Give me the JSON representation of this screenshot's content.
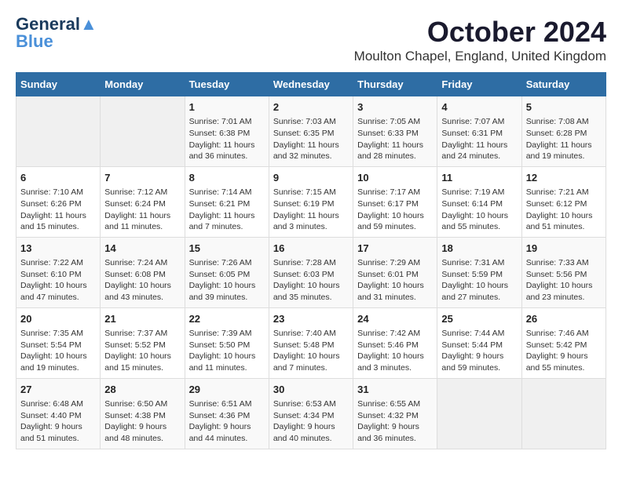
{
  "logo": {
    "line1": "General",
    "line2": "Blue"
  },
  "header": {
    "month_title": "October 2024",
    "location": "Moulton Chapel, England, United Kingdom"
  },
  "days_of_week": [
    "Sunday",
    "Monday",
    "Tuesday",
    "Wednesday",
    "Thursday",
    "Friday",
    "Saturday"
  ],
  "weeks": [
    [
      {
        "day": "",
        "content": ""
      },
      {
        "day": "",
        "content": ""
      },
      {
        "day": "1",
        "content": "Sunrise: 7:01 AM\nSunset: 6:38 PM\nDaylight: 11 hours\nand 36 minutes."
      },
      {
        "day": "2",
        "content": "Sunrise: 7:03 AM\nSunset: 6:35 PM\nDaylight: 11 hours\nand 32 minutes."
      },
      {
        "day": "3",
        "content": "Sunrise: 7:05 AM\nSunset: 6:33 PM\nDaylight: 11 hours\nand 28 minutes."
      },
      {
        "day": "4",
        "content": "Sunrise: 7:07 AM\nSunset: 6:31 PM\nDaylight: 11 hours\nand 24 minutes."
      },
      {
        "day": "5",
        "content": "Sunrise: 7:08 AM\nSunset: 6:28 PM\nDaylight: 11 hours\nand 19 minutes."
      }
    ],
    [
      {
        "day": "6",
        "content": "Sunrise: 7:10 AM\nSunset: 6:26 PM\nDaylight: 11 hours\nand 15 minutes."
      },
      {
        "day": "7",
        "content": "Sunrise: 7:12 AM\nSunset: 6:24 PM\nDaylight: 11 hours\nand 11 minutes."
      },
      {
        "day": "8",
        "content": "Sunrise: 7:14 AM\nSunset: 6:21 PM\nDaylight: 11 hours\nand 7 minutes."
      },
      {
        "day": "9",
        "content": "Sunrise: 7:15 AM\nSunset: 6:19 PM\nDaylight: 11 hours\nand 3 minutes."
      },
      {
        "day": "10",
        "content": "Sunrise: 7:17 AM\nSunset: 6:17 PM\nDaylight: 10 hours\nand 59 minutes."
      },
      {
        "day": "11",
        "content": "Sunrise: 7:19 AM\nSunset: 6:14 PM\nDaylight: 10 hours\nand 55 minutes."
      },
      {
        "day": "12",
        "content": "Sunrise: 7:21 AM\nSunset: 6:12 PM\nDaylight: 10 hours\nand 51 minutes."
      }
    ],
    [
      {
        "day": "13",
        "content": "Sunrise: 7:22 AM\nSunset: 6:10 PM\nDaylight: 10 hours\nand 47 minutes."
      },
      {
        "day": "14",
        "content": "Sunrise: 7:24 AM\nSunset: 6:08 PM\nDaylight: 10 hours\nand 43 minutes."
      },
      {
        "day": "15",
        "content": "Sunrise: 7:26 AM\nSunset: 6:05 PM\nDaylight: 10 hours\nand 39 minutes."
      },
      {
        "day": "16",
        "content": "Sunrise: 7:28 AM\nSunset: 6:03 PM\nDaylight: 10 hours\nand 35 minutes."
      },
      {
        "day": "17",
        "content": "Sunrise: 7:29 AM\nSunset: 6:01 PM\nDaylight: 10 hours\nand 31 minutes."
      },
      {
        "day": "18",
        "content": "Sunrise: 7:31 AM\nSunset: 5:59 PM\nDaylight: 10 hours\nand 27 minutes."
      },
      {
        "day": "19",
        "content": "Sunrise: 7:33 AM\nSunset: 5:56 PM\nDaylight: 10 hours\nand 23 minutes."
      }
    ],
    [
      {
        "day": "20",
        "content": "Sunrise: 7:35 AM\nSunset: 5:54 PM\nDaylight: 10 hours\nand 19 minutes."
      },
      {
        "day": "21",
        "content": "Sunrise: 7:37 AM\nSunset: 5:52 PM\nDaylight: 10 hours\nand 15 minutes."
      },
      {
        "day": "22",
        "content": "Sunrise: 7:39 AM\nSunset: 5:50 PM\nDaylight: 10 hours\nand 11 minutes."
      },
      {
        "day": "23",
        "content": "Sunrise: 7:40 AM\nSunset: 5:48 PM\nDaylight: 10 hours\nand 7 minutes."
      },
      {
        "day": "24",
        "content": "Sunrise: 7:42 AM\nSunset: 5:46 PM\nDaylight: 10 hours\nand 3 minutes."
      },
      {
        "day": "25",
        "content": "Sunrise: 7:44 AM\nSunset: 5:44 PM\nDaylight: 9 hours\nand 59 minutes."
      },
      {
        "day": "26",
        "content": "Sunrise: 7:46 AM\nSunset: 5:42 PM\nDaylight: 9 hours\nand 55 minutes."
      }
    ],
    [
      {
        "day": "27",
        "content": "Sunrise: 6:48 AM\nSunset: 4:40 PM\nDaylight: 9 hours\nand 51 minutes."
      },
      {
        "day": "28",
        "content": "Sunrise: 6:50 AM\nSunset: 4:38 PM\nDaylight: 9 hours\nand 48 minutes."
      },
      {
        "day": "29",
        "content": "Sunrise: 6:51 AM\nSunset: 4:36 PM\nDaylight: 9 hours\nand 44 minutes."
      },
      {
        "day": "30",
        "content": "Sunrise: 6:53 AM\nSunset: 4:34 PM\nDaylight: 9 hours\nand 40 minutes."
      },
      {
        "day": "31",
        "content": "Sunrise: 6:55 AM\nSunset: 4:32 PM\nDaylight: 9 hours\nand 36 minutes."
      },
      {
        "day": "",
        "content": ""
      },
      {
        "day": "",
        "content": ""
      }
    ]
  ]
}
